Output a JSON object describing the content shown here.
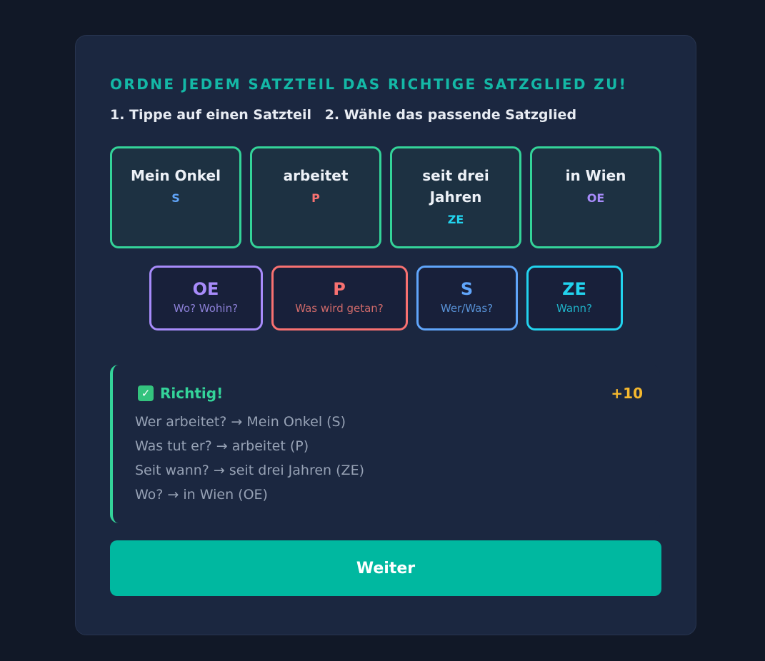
{
  "heading": "ORDNE JEDEM SATZTEIL DAS RICHTIGE SATZGLIED ZU!",
  "instructions": {
    "step1": "1. Tippe auf einen Satzteil",
    "step2": "2. Wähle das passende Satzglied"
  },
  "tiles": [
    {
      "text": "Mein Onkel",
      "tag": "S",
      "tag_color": "#60a5fa"
    },
    {
      "text": "arbeitet",
      "tag": "P",
      "tag_color": "#f87171"
    },
    {
      "text": "seit drei Jahren",
      "tag": "ZE",
      "tag_color": "#22d3ee"
    },
    {
      "text": "in Wien",
      "tag": "OE",
      "tag_color": "#a78bfa"
    }
  ],
  "options": [
    {
      "code": "OE",
      "hint": "Wo? Wohin?",
      "color": "#a78bfa",
      "hint_color": "#8b7fd6"
    },
    {
      "code": "P",
      "hint": "Was wird getan?",
      "color": "#f87171",
      "hint_color": "#d06a6a"
    },
    {
      "code": "S",
      "hint": "Wer/Was?",
      "color": "#60a5fa",
      "hint_color": "#5790d4"
    },
    {
      "code": "ZE",
      "hint": "Wann?",
      "color": "#22d3ee",
      "hint_color": "#1fb3c9"
    }
  ],
  "feedback": {
    "icon": "checkmark-icon",
    "title": "Richtig!",
    "points": "+10",
    "lines": [
      "Wer arbeitet? → Mein Onkel (S)",
      "Was tut er? → arbeitet (P)",
      "Seit wann? → seit drei Jahren (ZE)",
      "Wo? → in Wien (OE)"
    ]
  },
  "next_label": "Weiter",
  "colors": {
    "accent": "#14b8a6",
    "correct": "#34d399",
    "button": "#00b8a0",
    "points": "#f5b82e"
  }
}
